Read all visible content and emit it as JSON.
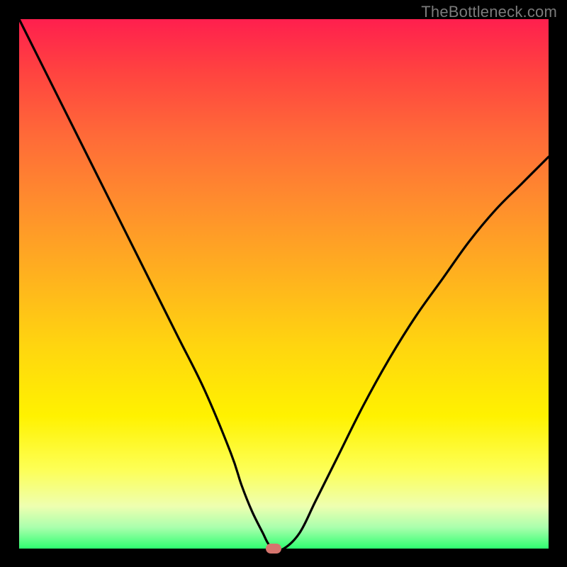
{
  "watermark": "TheBottleneck.com",
  "chart_data": {
    "type": "line",
    "title": "",
    "xlabel": "",
    "ylabel": "",
    "xlim": [
      0,
      100
    ],
    "ylim": [
      0,
      100
    ],
    "series": [
      {
        "name": "curve",
        "x": [
          0,
          5,
          10,
          15,
          20,
          25,
          30,
          35,
          40,
          42,
          44,
          46,
          47,
          48,
          50,
          53,
          56,
          60,
          65,
          70,
          75,
          80,
          85,
          90,
          95,
          100
        ],
        "y": [
          100,
          90,
          80,
          70,
          60,
          50,
          40,
          30,
          18,
          12,
          7,
          3,
          1,
          0,
          0,
          3,
          9,
          17,
          27,
          36,
          44,
          51,
          58,
          64,
          69,
          74
        ]
      }
    ],
    "marker": {
      "x": 48,
      "y": 0
    },
    "background_gradient": {
      "top": "#ff1f4e",
      "mid": "#fff200",
      "bottom": "#2fff70"
    }
  }
}
